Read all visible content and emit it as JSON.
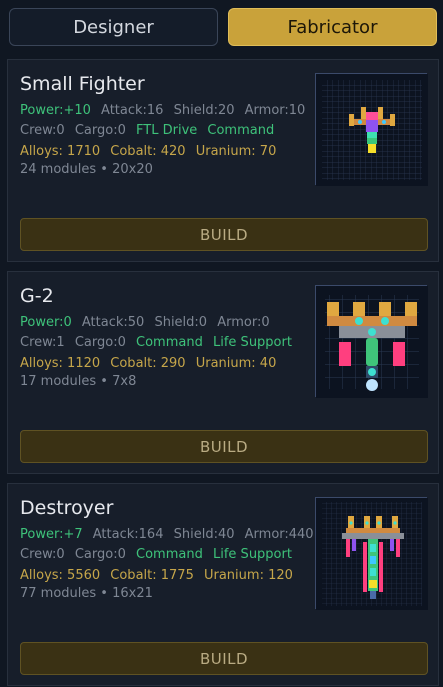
{
  "tabs": {
    "designer": "Designer",
    "fabricator": "Fabricator"
  },
  "ships": [
    {
      "name": "Small Fighter",
      "power": "Power:+10",
      "attack": "Attack:16",
      "shield": "Shield:20",
      "armor": "Armor:10",
      "crew": "Crew:0",
      "cargo": "Cargo:0",
      "tags": [
        "FTL Drive",
        "Command"
      ],
      "alloys": "Alloys: 1710",
      "cobalt": "Cobalt: 420",
      "uranium": "Uranium: 70",
      "meta": "24 modules • 20x20",
      "build_label": "BUILD"
    },
    {
      "name": "G-2",
      "power": "Power:0",
      "attack": "Attack:50",
      "shield": "Shield:0",
      "armor": "Armor:0",
      "crew": "Crew:1",
      "cargo": "Cargo:0",
      "tags": [
        "Command",
        "Life Support"
      ],
      "alloys": "Alloys: 1120",
      "cobalt": "Cobalt: 290",
      "uranium": "Uranium: 40",
      "meta": "17 modules • 7x8",
      "build_label": "BUILD"
    },
    {
      "name": "Destroyer",
      "power": "Power:+7",
      "attack": "Attack:164",
      "shield": "Shield:40",
      "armor": "Armor:440",
      "crew": "Crew:0",
      "cargo": "Cargo:0",
      "tags": [
        "Command",
        "Life Support"
      ],
      "alloys": "Alloys: 5560",
      "cobalt": "Cobalt: 1775",
      "uranium": "Uranium: 120",
      "meta": "77 modules • 16x21",
      "build_label": "BUILD"
    }
  ],
  "colors": {
    "accent": "#c9a23a",
    "green": "#3ec27a",
    "dim": "#7f8794",
    "gold": "#c6a64a",
    "build_bg": "#3a3114"
  }
}
